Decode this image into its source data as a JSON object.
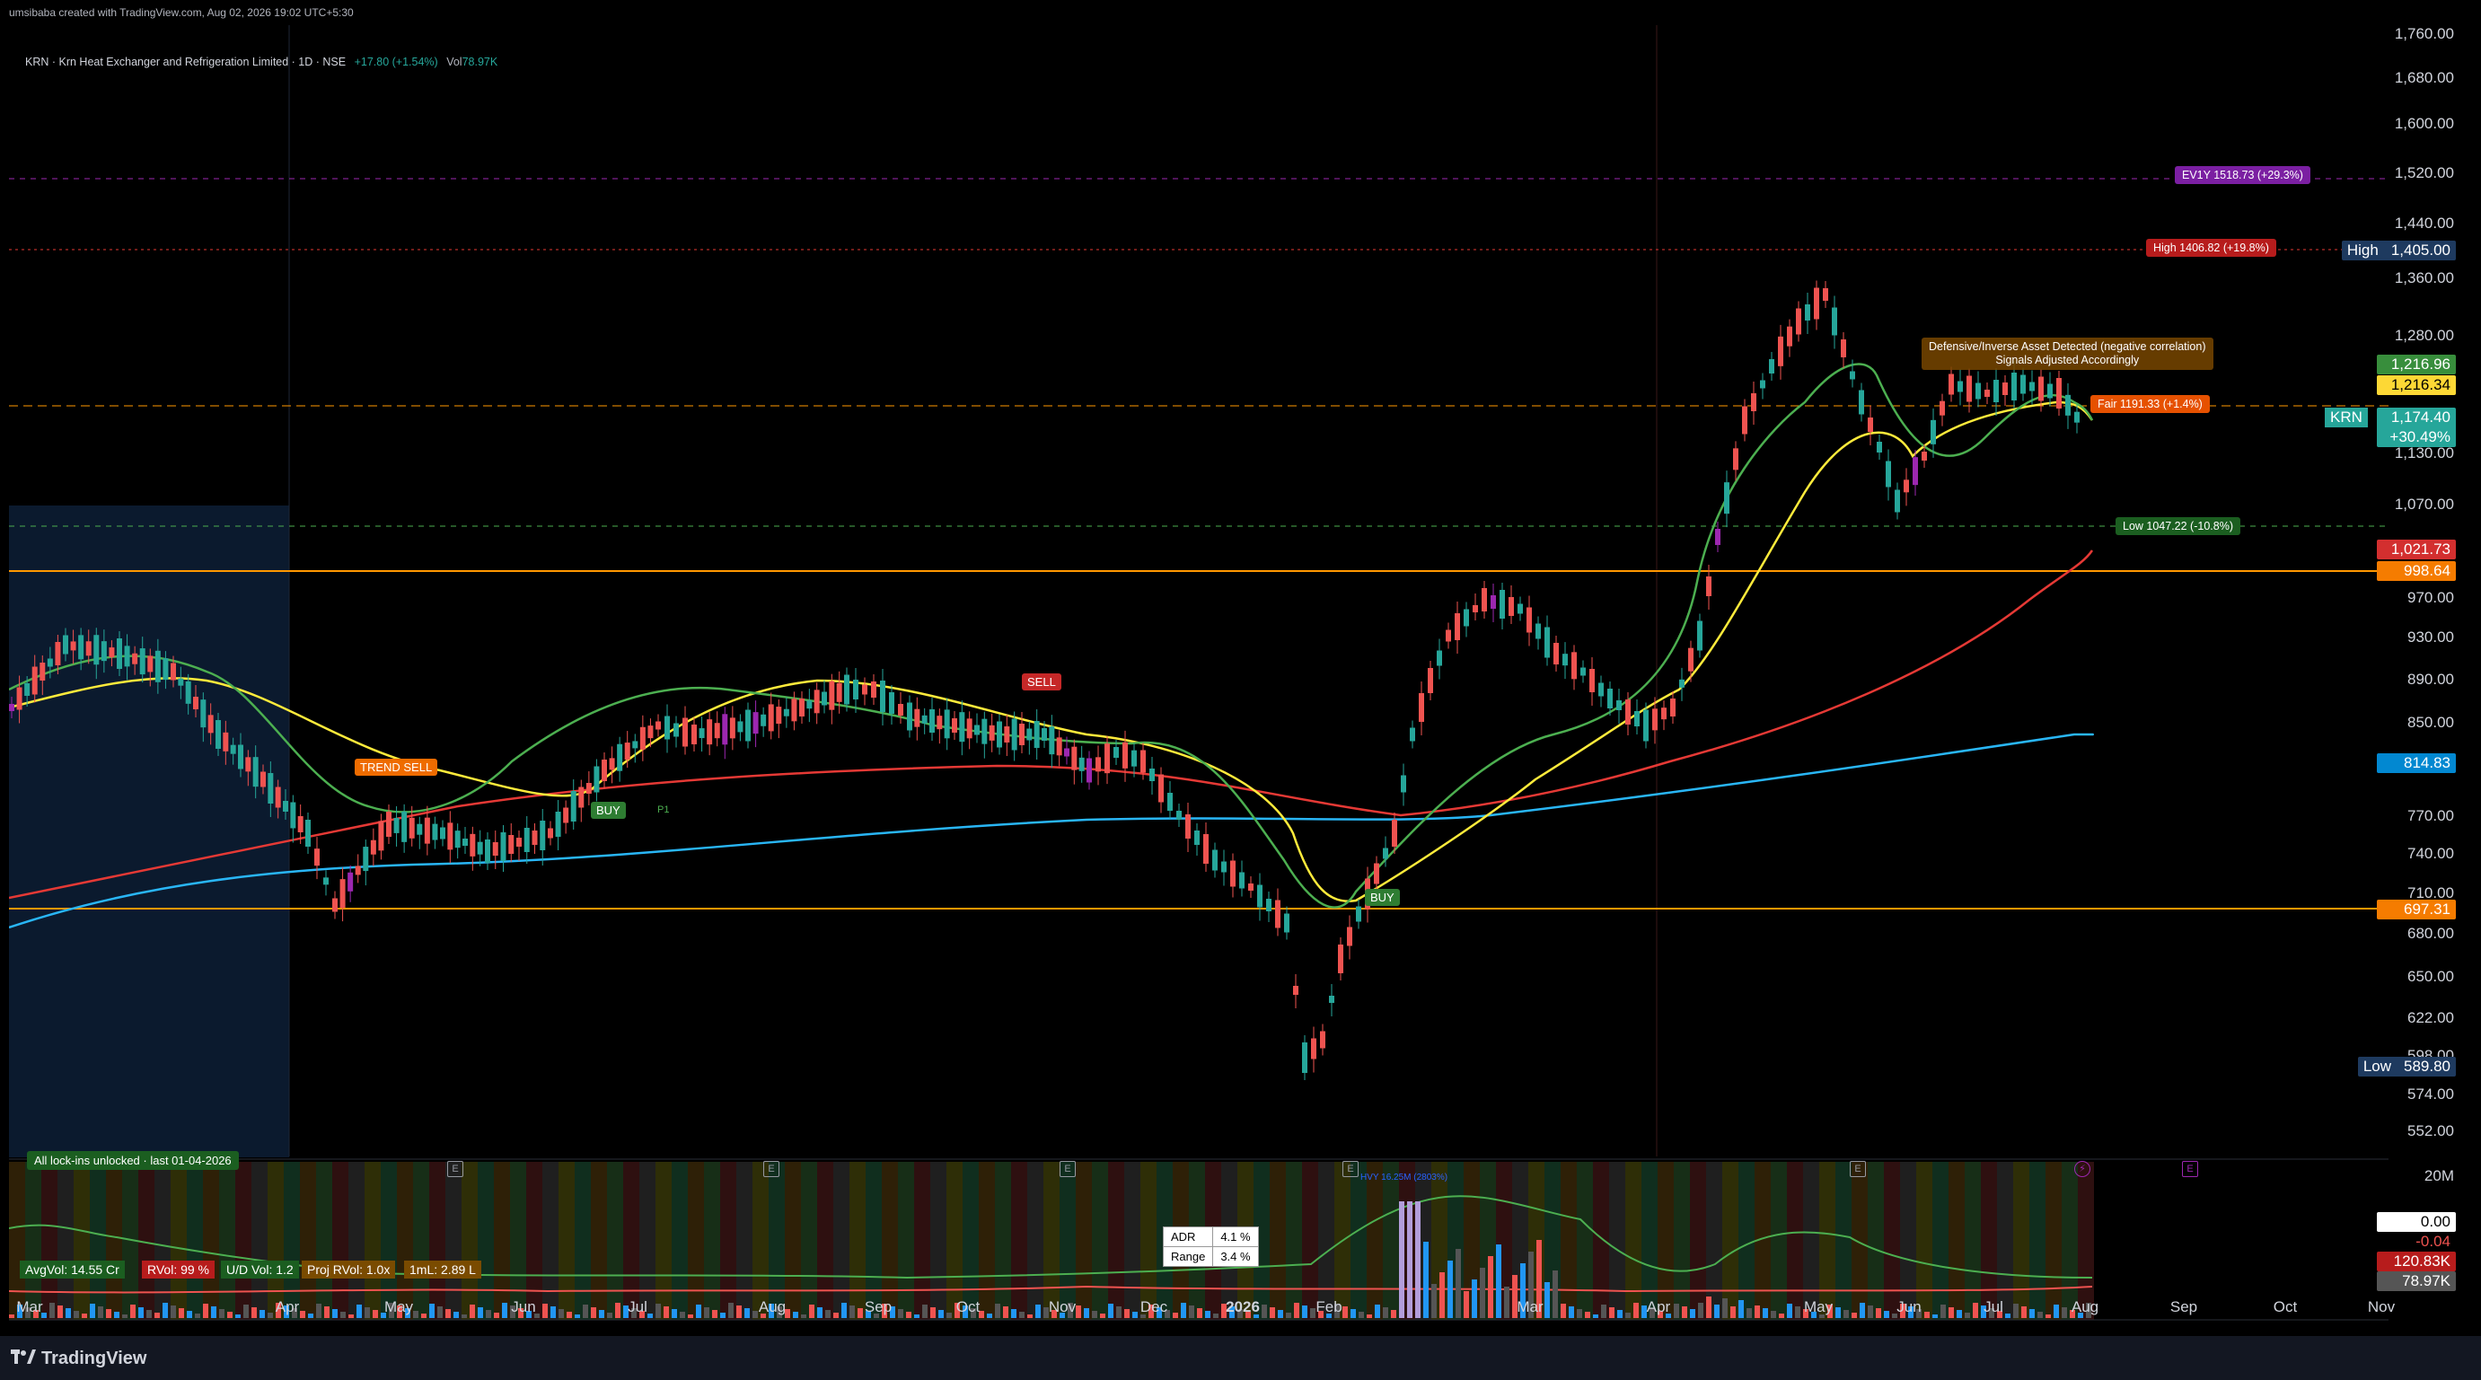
{
  "header": {
    "created_by": "umsibaba created with TradingView.com, Aug 02, 2026 19:02 UTC+5:30"
  },
  "legend": {
    "symbol": "KRN · Krn Heat Exchanger and Refrigeration Limited · 1D · NSE",
    "change": "+17.80 (+1.54%)",
    "vol_label": "Vol",
    "vol_value": "78.97K"
  },
  "price_axis": {
    "ticks": [
      "1,760.00",
      "1,680.00",
      "1,600.00",
      "1,520.00",
      "1,440.00",
      "1,360.00",
      "1,280.00",
      "1,130.00",
      "1,070.00",
      "970.00",
      "930.00",
      "890.00",
      "850.00",
      "770.00",
      "740.00",
      "710.00",
      "680.00",
      "650.00",
      "622.00",
      "598.00",
      "574.00",
      "552.00"
    ]
  },
  "price_tags": {
    "high_label": "High",
    "high_value": "1,405.00",
    "t1": "1,216.96",
    "t2": "1,216.34",
    "krn_label": "KRN",
    "krn_value": "1,174.40",
    "krn_change": "+30.49%",
    "t_red": "1,021.73",
    "t_orange_hi": "998.64",
    "t_blue": "814.83",
    "t_orange_lo": "697.31",
    "low_label": "Low",
    "low_value": "589.80"
  },
  "annotations": {
    "ev1y": "EV1Y 1518.73 (+29.3%)",
    "high": "High 1406.82 (+19.8%)",
    "fair": "Fair 1191.33 (+1.4%)",
    "low": "Low 1047.22 (-10.8%)",
    "defensive": "Defensive/Inverse Asset Detected (negative correlation)",
    "defensive_sub": "Signals Adjusted Accordingly"
  },
  "signals": {
    "trend_sell": "TREND SELL",
    "buy1": "BUY",
    "p1": "P1",
    "sell": "SELL",
    "buy2": "BUY"
  },
  "lock_note": "All lock-ins unlocked · last 01-04-2026",
  "volume_panel": {
    "axis_top": "20M",
    "tag_white": "0.00",
    "tag_red": "-0.04",
    "tag_dark": "120.83K",
    "tag_gray": "78.97K",
    "hvy_label": "HVY 16.25M (2803%)",
    "avgvol": "AvgVol: 14.55 Cr",
    "rvol": "RVol: 99 %",
    "udvol": "U/D Vol: 1.2",
    "projrvol": "Proj RVol: 1.0x",
    "oneml": "1mL: 2.89 L",
    "adr_label": "ADR",
    "adr_value": "4.1 %",
    "range_label": "Range",
    "range_value": "3.4 %"
  },
  "time_axis": {
    "months": [
      "Mar",
      "Apr",
      "May",
      "Jun",
      "Jul",
      "Aug",
      "Sep",
      "Oct",
      "Nov",
      "Dec",
      "2026",
      "Feb",
      "Mar",
      "Apr",
      "May",
      "Jun",
      "Jul",
      "Aug",
      "Sep",
      "Oct",
      "Nov"
    ]
  },
  "footer": {
    "logo": "TradingView"
  },
  "colors": {
    "up": "#26a69a",
    "down": "#ef5350",
    "purple": "#9c27b0",
    "blue": "#2962ff",
    "ma_green": "#4caf50",
    "ma_yellow": "#ffeb3b",
    "ma_red": "#e53935",
    "ma_blue": "#29b6f6",
    "orange_line": "#ff9800"
  },
  "chart_data": {
    "type": "candlestick",
    "symbol": "KRN",
    "exchange": "NSE",
    "interval": "1D",
    "x_range": [
      "Mar 2025",
      "Nov 2026"
    ],
    "y_range": [
      552,
      1760
    ],
    "y_scale": "log",
    "levels": {
      "ev1y": 1518.73,
      "high": 1406.82,
      "fair": 1191.33,
      "low": 1047.22,
      "orange_upper": 998.64,
      "orange_lower": 697.31
    },
    "close_path": [
      {
        "x": "Mar 2025",
        "y": 900
      },
      {
        "x": "Mar 2025",
        "y": 930
      },
      {
        "x": "Apr 2025",
        "y": 890
      },
      {
        "x": "Apr 2025",
        "y": 830
      },
      {
        "x": "May 2025",
        "y": 730
      },
      {
        "x": "May 2025",
        "y": 770
      },
      {
        "x": "Jun 2025",
        "y": 750
      },
      {
        "x": "Jul 2025",
        "y": 880
      },
      {
        "x": "Jul 2025",
        "y": 850
      },
      {
        "x": "Aug 2025",
        "y": 880
      },
      {
        "x": "Sep 2025",
        "y": 900
      },
      {
        "x": "Oct 2025",
        "y": 860
      },
      {
        "x": "Nov 2025",
        "y": 840
      },
      {
        "x": "Dec 2025",
        "y": 770
      },
      {
        "x": "Jan 2026",
        "y": 700
      },
      {
        "x": "Jan 2026",
        "y": 610
      },
      {
        "x": "Feb 2026",
        "y": 720
      },
      {
        "x": "Feb 2026",
        "y": 900
      },
      {
        "x": "Mar 2026",
        "y": 960
      },
      {
        "x": "Mar 2026",
        "y": 900
      },
      {
        "x": "Apr 2026",
        "y": 860
      },
      {
        "x": "Apr 2026",
        "y": 1060
      },
      {
        "x": "Apr 2026",
        "y": 1280
      },
      {
        "x": "May 2026",
        "y": 1380
      },
      {
        "x": "May 2026",
        "y": 1300
      },
      {
        "x": "Jun 2026",
        "y": 1100
      },
      {
        "x": "Jun 2026",
        "y": 1200
      },
      {
        "x": "Jul 2026",
        "y": 1240
      },
      {
        "x": "Aug 2026",
        "y": 1174.4
      }
    ]
  }
}
